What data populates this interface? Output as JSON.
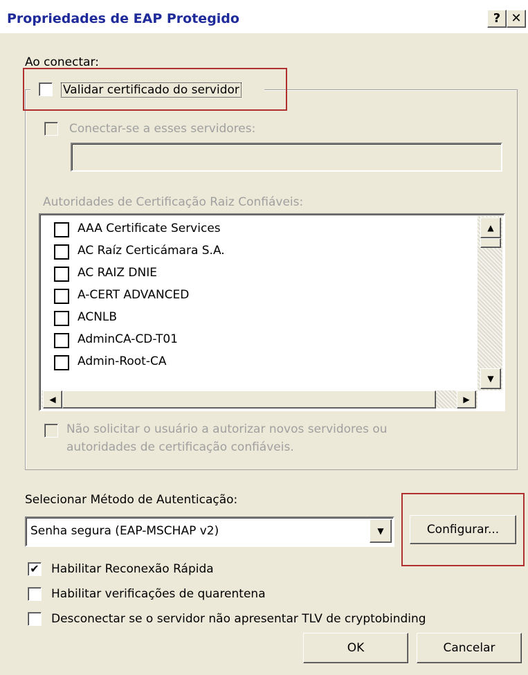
{
  "window": {
    "title": "Propriedades de EAP Protegido",
    "help_glyph": "?",
    "close_glyph": "✕"
  },
  "connect": {
    "heading": "Ao conectar:",
    "validate_cert_label": "Validar certificado do servidor",
    "validate_cert_checked": false,
    "connect_servers_label": "Conectar-se a esses servidores:",
    "servers_value": "",
    "trusted_roots_label": "Autoridades de Certificação Raiz Confiáveis:",
    "ca_list": [
      "AAA Certificate Services",
      "AC Raíz Certicámara S.A.",
      "AC RAIZ DNIE",
      "A-CERT ADVANCED",
      "ACNLB",
      "AdminCA-CD-T01",
      "Admin-Root-CA"
    ],
    "no_prompt_line1": "Não solicitar o usuário a autorizar novos servidores ou",
    "no_prompt_line2": "autoridades de certificação confiáveis."
  },
  "auth": {
    "method_label": "Selecionar Método de Autenticação:",
    "method_value": "Senha segura (EAP-MSCHAP v2)",
    "configure_button": "Configurar...",
    "fast_reconnect_label": "Habilitar Reconexão Rápida",
    "fast_reconnect_checked": true,
    "quarantine_label": "Habilitar verificações de quarentena",
    "quarantine_checked": false,
    "cryptobinding_label": "Desconectar se o servidor não apresentar TLV de cryptobinding",
    "cryptobinding_checked": false
  },
  "buttons": {
    "ok": "OK",
    "cancel": "Cancelar"
  },
  "colors": {
    "dialog_bg": "#ECE9D8",
    "title_text": "#1f2a9a",
    "annotation_red": "#b03030",
    "disabled_text": "#a0a0a0"
  }
}
